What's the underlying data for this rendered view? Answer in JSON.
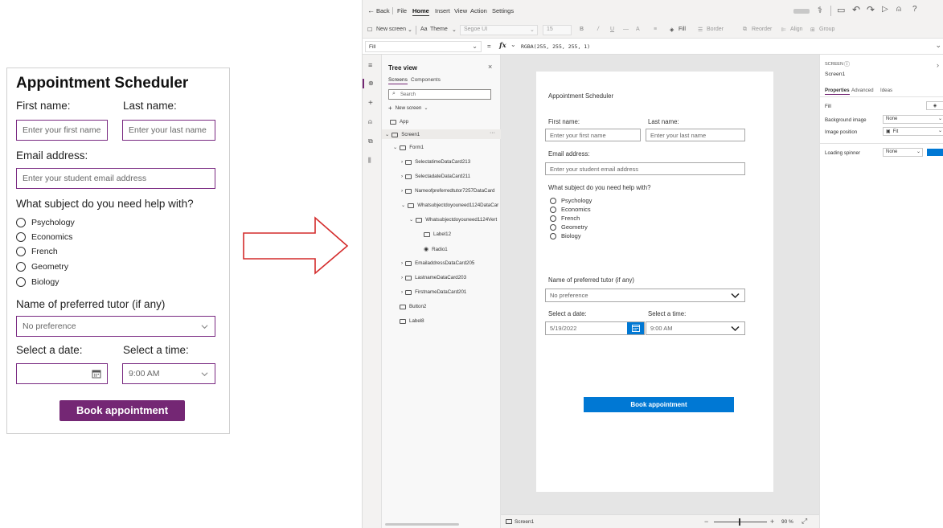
{
  "mockup": {
    "title": "Appointment Scheduler",
    "first_name_label": "First name:",
    "last_name_label": "Last name:",
    "first_name_placeholder": "Enter your first name",
    "last_name_placeholder": "Enter your last name",
    "email_label": "Email address:",
    "email_placeholder": "Enter your student email address",
    "subject_label": "What subject do you need help with?",
    "subjects": [
      "Psychology",
      "Economics",
      "French",
      "Geometry",
      "Biology"
    ],
    "tutor_label": "Name of preferred tutor (if any)",
    "tutor_value": "No preference",
    "date_label": "Select a date:",
    "time_label": "Select a time:",
    "time_value": "9:00 AM",
    "book_button": "Book appointment",
    "accent_color": "#742774"
  },
  "studio": {
    "menu": {
      "back": "Back",
      "file": "File",
      "home": "Home",
      "insert": "Insert",
      "view": "View",
      "action": "Action",
      "settings": "Settings"
    },
    "toolbar": {
      "new_screen": "New screen",
      "theme": "Theme",
      "font": "Segoe UI",
      "font_size": "15",
      "fill": "Fill",
      "border": "Border",
      "reorder": "Reorder",
      "align": "Align",
      "group": "Group"
    },
    "formula": {
      "property": "Fill",
      "fx": "fx",
      "value": "RGBA(255, 255, 255, 1)"
    },
    "tree": {
      "title": "Tree view",
      "tab_screens": "Screens",
      "tab_components": "Components",
      "search_placeholder": "Search",
      "new_screen": "New screen",
      "app": "App",
      "screen1": "Screen1",
      "form1": "Form1",
      "cards": [
        "SelectatimeDataCard213",
        "SelectadateDataCard211",
        "Nameofpreferredtutor7257DataCard",
        "Whatsubjectdoyouneed1124DataCar",
        "Whatsubjectdoyouneed1124Vert",
        "Label12",
        "Radio1",
        "EmailaddressDataCard205",
        "LastnameDataCard203",
        "FirstnameDataCard201"
      ],
      "button2": "Button2",
      "label8": "Label8"
    },
    "screen": {
      "title": "Appointment Scheduler",
      "first_name_label": "First name:",
      "last_name_label": "Last name:",
      "first_name_placeholder": "Enter your first name",
      "last_name_placeholder": "Enter your last name",
      "email_label": "Email address:",
      "email_placeholder": "Enter your student email address",
      "subject_label": "What subject do you need help with?",
      "subjects": [
        "Psychology",
        "Economics",
        "French",
        "Geometry",
        "Biology"
      ],
      "tutor_label": "Name of preferred tutor (if any)",
      "tutor_value": "No preference",
      "date_label": "Select a date:",
      "time_label": "Select a time:",
      "date_value": "5/19/2022",
      "time_value": "9:00 AM",
      "book_button": "Book appointment",
      "accent_color": "#0078d4"
    },
    "status": {
      "screen": "Screen1",
      "zoom": "90 %"
    },
    "props": {
      "section": "SCREEN",
      "name": "Screen1",
      "tab_properties": "Properties",
      "tab_advanced": "Advanced",
      "tab_ideas": "Ideas",
      "fill": "Fill",
      "background_image": "Background image",
      "background_image_value": "None",
      "image_position": "Image position",
      "image_position_value": "Fit",
      "loading_spinner": "Loading spinner",
      "loading_spinner_value": "None"
    }
  }
}
